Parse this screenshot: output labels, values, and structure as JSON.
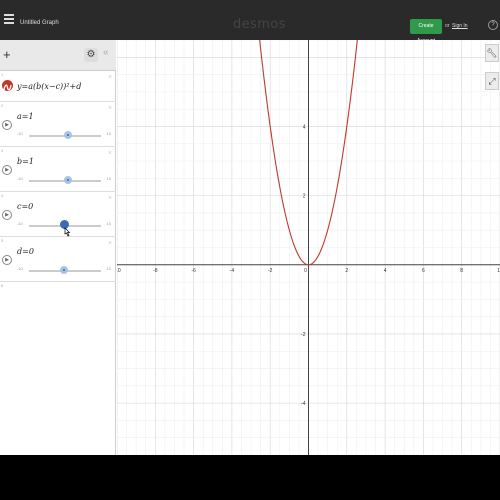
{
  "header": {
    "title": "Untitled Graph",
    "brand": "desmos",
    "create_account": "Create Account",
    "or": "or",
    "sign_in": "Sign In",
    "help": "?"
  },
  "panel": {
    "add": "+",
    "settings_icon": "gear-icon",
    "collapse": "«"
  },
  "expressions": [
    {
      "index": "1",
      "latex": "y=a(b(x−c))²+d"
    },
    {
      "index": "2",
      "latex": "a=1",
      "min": "-10",
      "max": "10",
      "value": 1
    },
    {
      "index": "3",
      "latex": "b=1",
      "min": "-10",
      "max": "10",
      "value": 1
    },
    {
      "index": "4",
      "latex": "c=0",
      "min": "-10",
      "max": "10",
      "value": 0
    },
    {
      "index": "5",
      "latex": "d=0",
      "min": "-10",
      "max": "10",
      "value": 0
    },
    {
      "index": "6"
    }
  ],
  "graph": {
    "x_ticks": [
      "-10",
      "-8",
      "-6",
      "-4",
      "-2",
      "0",
      "2",
      "4",
      "6",
      "8",
      "10"
    ],
    "y_ticks": [
      "4",
      "2",
      "-2",
      "-4"
    ],
    "xlim": [
      -10,
      10
    ],
    "ylim": [
      -5.5,
      6.5
    ],
    "curve_color": "#c0392b",
    "grid": true
  },
  "tools": {
    "wrench": "wrench-icon",
    "zoom": "zoom-icon"
  }
}
